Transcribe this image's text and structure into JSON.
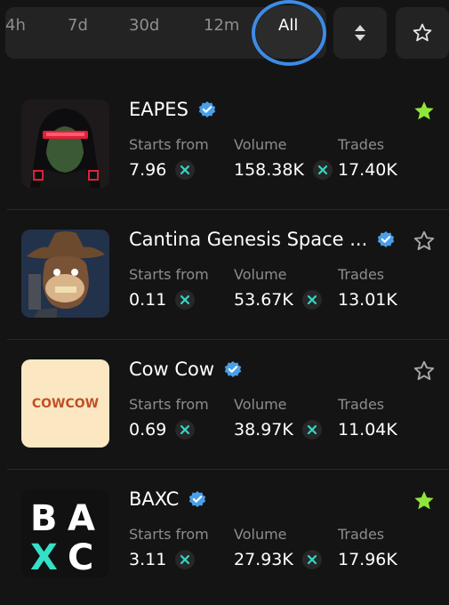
{
  "filters": {
    "ranges": [
      "4h",
      "7d",
      "30d",
      "12m",
      "All"
    ],
    "active": "All"
  },
  "icons": {
    "sort": "sort-updown-icon",
    "favorite": "star-outline-icon",
    "verified": "verified-check-icon",
    "currency": "x-token-icon"
  },
  "colors": {
    "accent_ring": "#3d8be6",
    "star_active": "#8fe63a",
    "verified": "#4a9fe8",
    "currency": "#35d6c6"
  },
  "labels": {
    "starts_from": "Starts from",
    "volume": "Volume",
    "trades": "Trades"
  },
  "collections": [
    {
      "name": "EAPES",
      "starts_from": "7.96",
      "volume": "158.38K",
      "trades": "17.40K",
      "favorited": true,
      "thumb": "hooded-ape"
    },
    {
      "name": "Cantina Genesis Space ...",
      "starts_from": "0.11",
      "volume": "53.67K",
      "trades": "13.01K",
      "favorited": false,
      "thumb": "cowboy-ape"
    },
    {
      "name": "Cow Cow",
      "starts_from": "0.69",
      "volume": "38.97K",
      "trades": "11.04K",
      "favorited": false,
      "thumb": "cowcow-logo",
      "thumb_text": "COWCOW"
    },
    {
      "name": "BAXC",
      "starts_from": "3.11",
      "volume": "27.93K",
      "trades": "17.96K",
      "favorited": true,
      "thumb": "baxc-logo",
      "thumb_text": "BAXC"
    }
  ]
}
